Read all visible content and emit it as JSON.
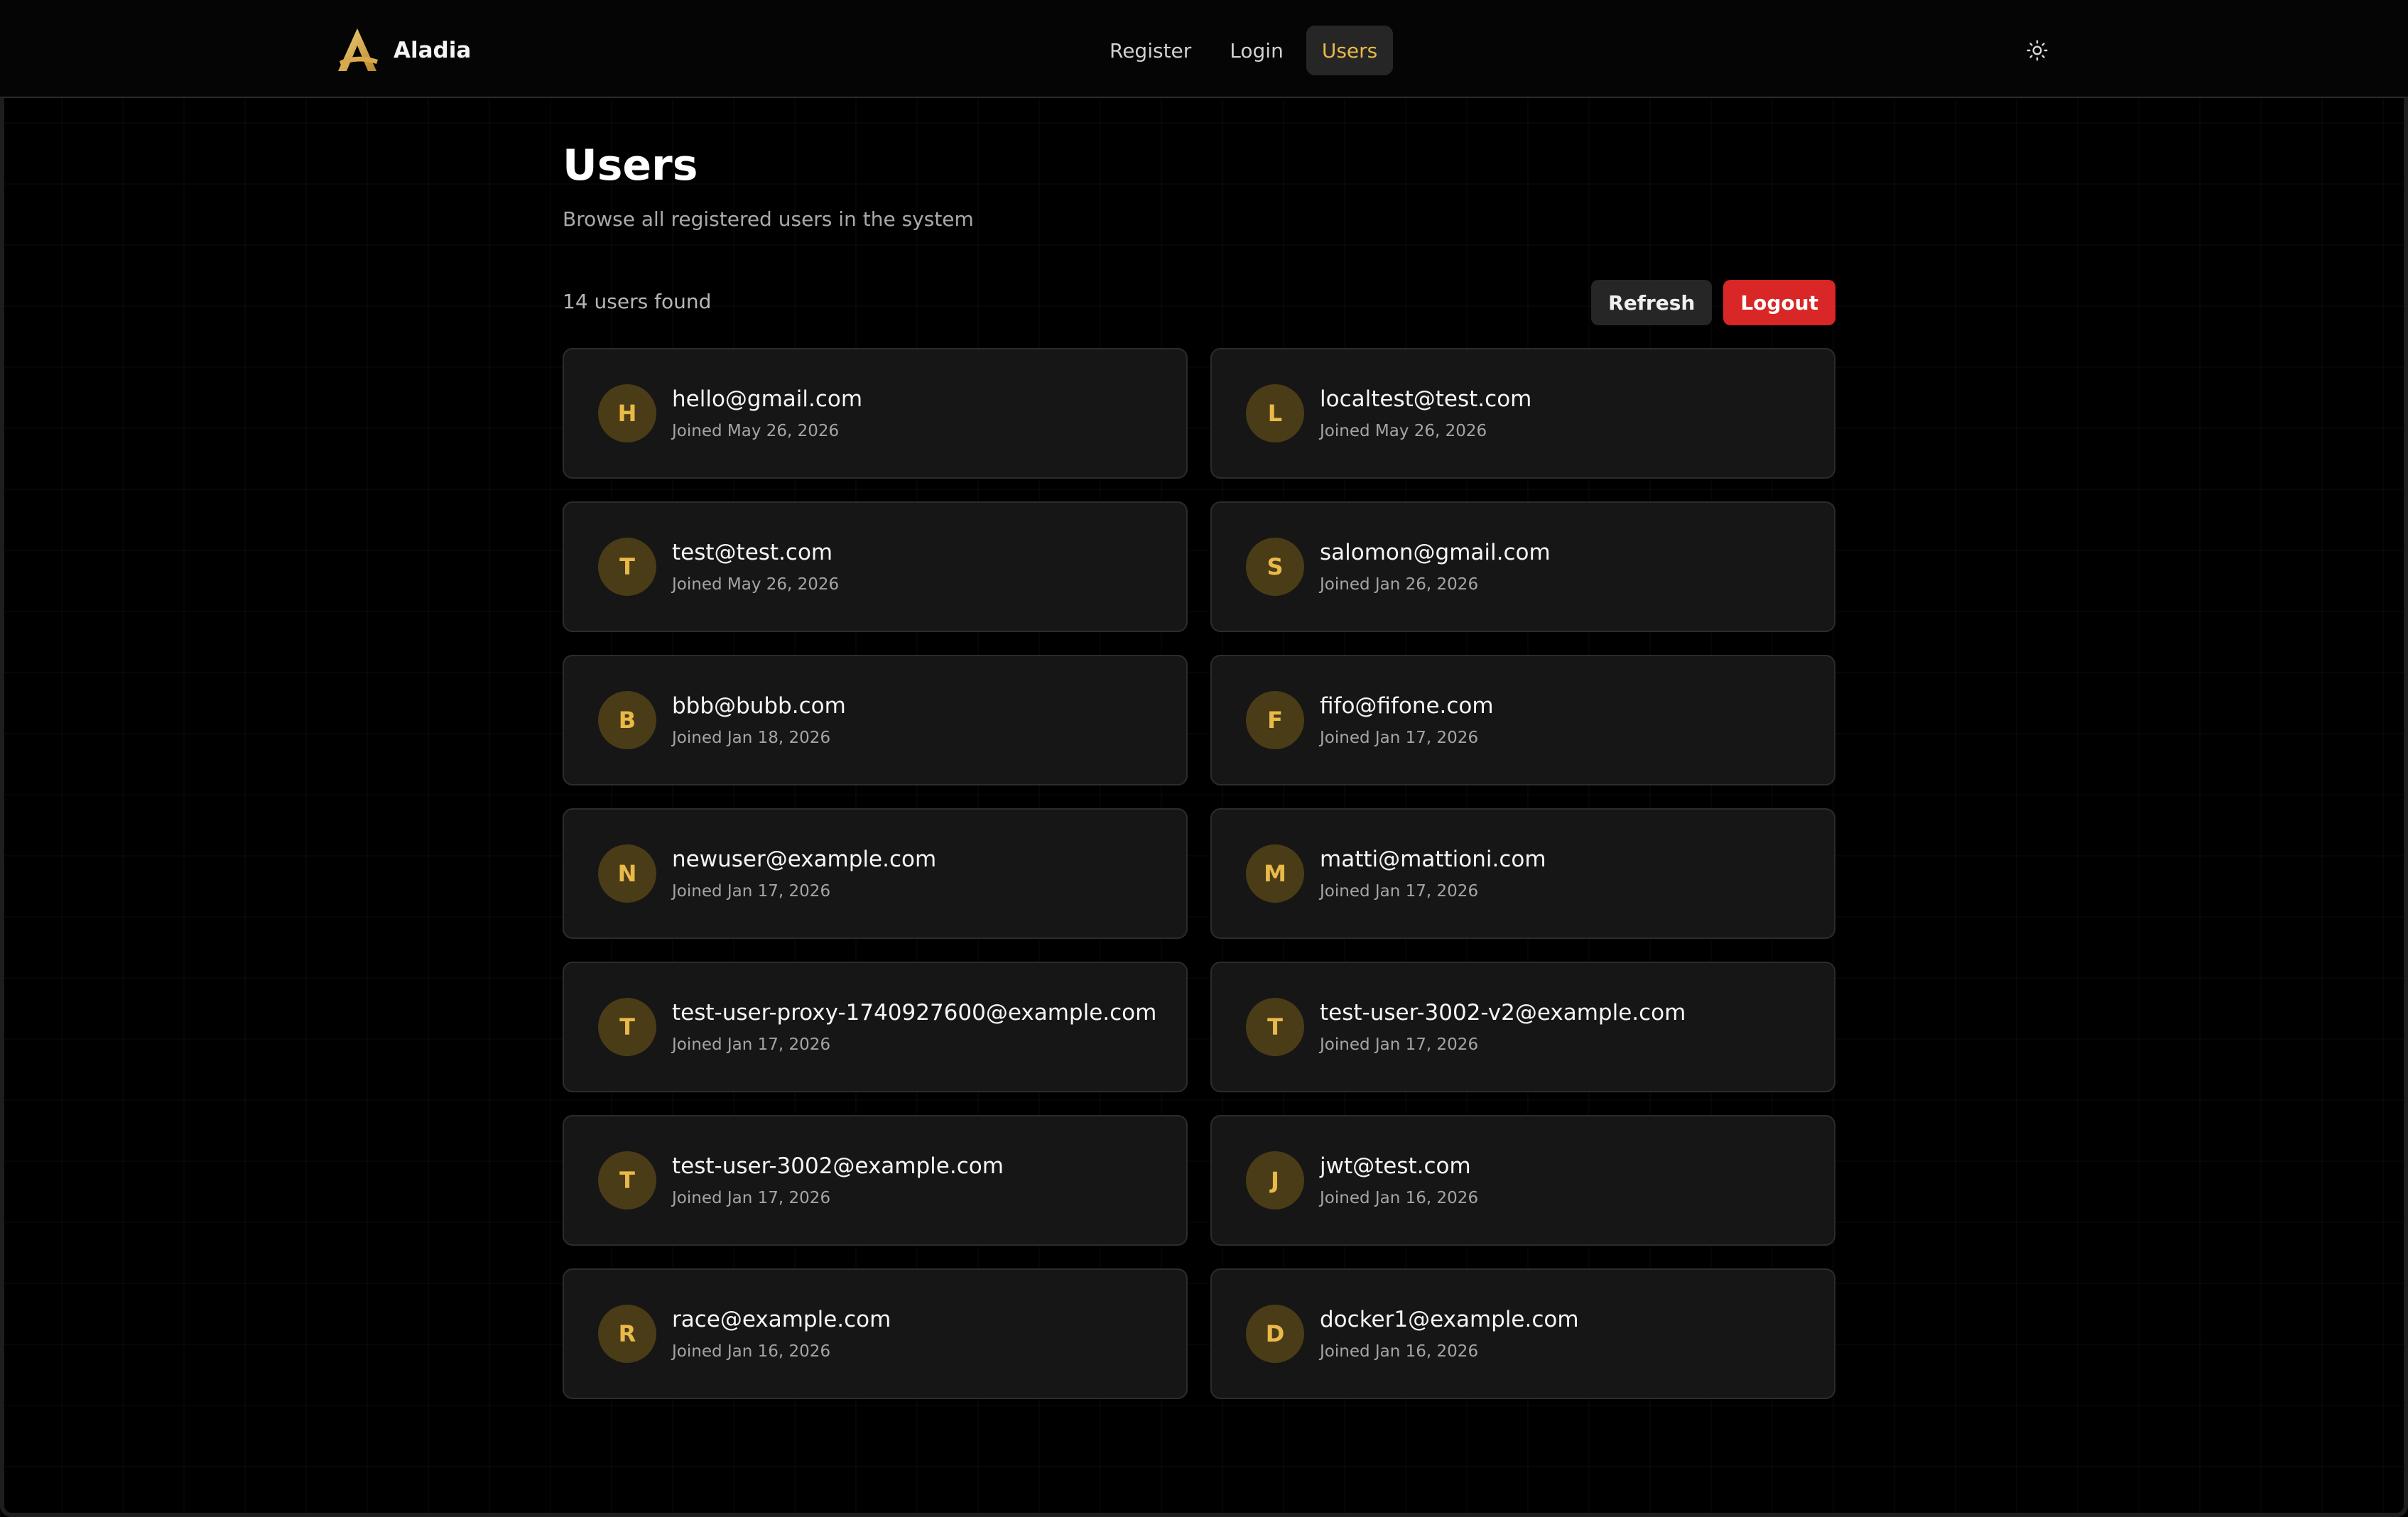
{
  "header": {
    "brand_name": "Aladia",
    "nav": [
      {
        "label": "Register",
        "active": false
      },
      {
        "label": "Login",
        "active": false
      },
      {
        "label": "Users",
        "active": true
      }
    ],
    "theme_toggle_icon": "sun-icon"
  },
  "page": {
    "title": "Users",
    "subtitle": "Browse all registered users in the system",
    "count_text": "14 users found",
    "refresh_label": "Refresh",
    "logout_label": "Logout"
  },
  "colors": {
    "accent": "#e9b949",
    "logout": "#d92626",
    "card_bg": "#161616",
    "avatar_bg": "#4a3c17"
  },
  "users": [
    {
      "initial": "H",
      "email": "hello@gmail.com",
      "joined": "Joined May 26, 2026"
    },
    {
      "initial": "L",
      "email": "localtest@test.com",
      "joined": "Joined May 26, 2026"
    },
    {
      "initial": "T",
      "email": "test@test.com",
      "joined": "Joined May 26, 2026"
    },
    {
      "initial": "S",
      "email": "salomon@gmail.com",
      "joined": "Joined Jan 26, 2026"
    },
    {
      "initial": "B",
      "email": "bbb@bubb.com",
      "joined": "Joined Jan 18, 2026"
    },
    {
      "initial": "F",
      "email": "fifo@fifone.com",
      "joined": "Joined Jan 17, 2026"
    },
    {
      "initial": "N",
      "email": "newuser@example.com",
      "joined": "Joined Jan 17, 2026"
    },
    {
      "initial": "M",
      "email": "matti@mattioni.com",
      "joined": "Joined Jan 17, 2026"
    },
    {
      "initial": "T",
      "email": "test-user-proxy-1740927600@example.com",
      "joined": "Joined Jan 17, 2026"
    },
    {
      "initial": "T",
      "email": "test-user-3002-v2@example.com",
      "joined": "Joined Jan 17, 2026"
    },
    {
      "initial": "T",
      "email": "test-user-3002@example.com",
      "joined": "Joined Jan 17, 2026"
    },
    {
      "initial": "J",
      "email": "jwt@test.com",
      "joined": "Joined Jan 16, 2026"
    },
    {
      "initial": "R",
      "email": "race@example.com",
      "joined": "Joined Jan 16, 2026"
    },
    {
      "initial": "D",
      "email": "docker1@example.com",
      "joined": "Joined Jan 16, 2026"
    }
  ]
}
